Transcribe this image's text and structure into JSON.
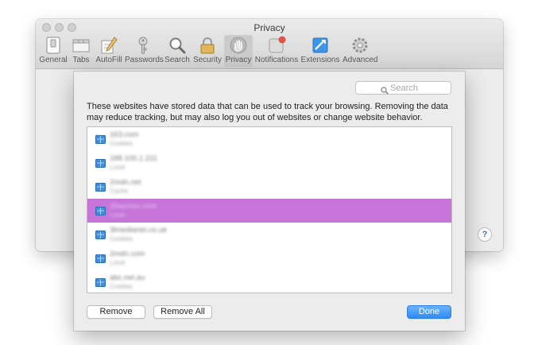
{
  "window": {
    "title": "Privacy",
    "toolbar": [
      {
        "label": "General",
        "icon": "switch-icon"
      },
      {
        "label": "Tabs",
        "icon": "tabs-icon"
      },
      {
        "label": "AutoFill",
        "icon": "pencil-icon"
      },
      {
        "label": "Passwords",
        "icon": "key-icon"
      },
      {
        "label": "Search",
        "icon": "magnifier-icon"
      },
      {
        "label": "Security",
        "icon": "padlock-icon"
      },
      {
        "label": "Privacy",
        "icon": "hand-icon",
        "selected": true
      },
      {
        "label": "Notifications",
        "icon": "notification-badge-icon"
      },
      {
        "label": "Extensions",
        "icon": "puzzle-icon"
      },
      {
        "label": "Advanced",
        "icon": "gear-icon"
      }
    ],
    "help_glyph": "?"
  },
  "sheet": {
    "search_placeholder": "Search",
    "description": "These websites have stored data that can be used to track your browsing. Removing the data may reduce tracking, but may also log you out of websites or change website behavior.",
    "sites": [
      {
        "name": "163.com",
        "data": "Cookies"
      },
      {
        "name": "188.100.1.211",
        "data": "Local"
      },
      {
        "name": "2mdn.net",
        "data": "Cache"
      },
      {
        "name": "33across.com",
        "data": "Local",
        "selected": true
      },
      {
        "name": "3lmedianet.co.uk",
        "data": "Cookies"
      },
      {
        "name": "2mdn.com",
        "data": "Local"
      },
      {
        "name": "abc.net.au",
        "data": "Cookies"
      }
    ],
    "remove_label": "Remove",
    "remove_all_label": "Remove All",
    "done_label": "Done"
  },
  "colors": {
    "selection": "#c674d9",
    "accent": "#2f8af4"
  }
}
